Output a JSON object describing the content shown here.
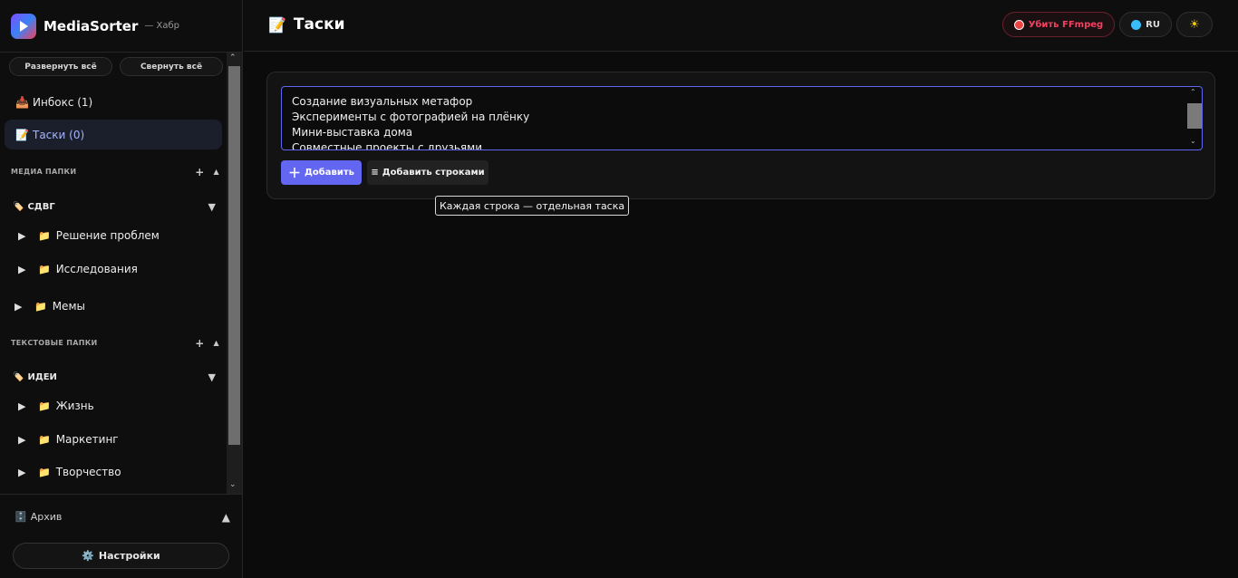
{
  "app": {
    "name": "MediaSorter",
    "subtitle": "— Хабр"
  },
  "sidebar": {
    "expand_all": "Развернуть всё",
    "collapse_all": "Свернуть всё",
    "nav": [
      {
        "icon": "📥",
        "label": "Инбокс (1)"
      },
      {
        "icon": "📝",
        "label": "Таски (0)"
      }
    ],
    "media_section": {
      "title": "медиа папки",
      "add": "+",
      "collapse": "▲"
    },
    "media_groups": [
      {
        "icon": "🏷️",
        "label": "СДВГ",
        "toggle": "▼",
        "folders": [
          "Решение проблем",
          "Исследования"
        ]
      }
    ],
    "media_root_folders": [
      "Мемы"
    ],
    "text_section": {
      "title": "текстовые папки",
      "add": "+",
      "collapse": "▲"
    },
    "text_groups": [
      {
        "icon": "🏷️",
        "label": "ИДЕИ",
        "toggle": "▼",
        "folders": [
          "Жизнь",
          "Маркетинг",
          "Творчество"
        ]
      }
    ],
    "archive": {
      "icon": "🗄️",
      "label": "Архив",
      "toggle": "▲"
    },
    "settings": {
      "icon": "⚙️",
      "label": "Настройки"
    }
  },
  "header": {
    "icon": "📝",
    "title": "Таски",
    "kill_ffmpeg": "Убить FFmpeg",
    "lang": "RU",
    "theme_icon": "☀"
  },
  "task_form": {
    "lines": [
      "Создание визуальных метафор",
      "Эксперименты с фотографией на плёнку",
      "Мини-выставка дома",
      "Совместные проекты с друзьями"
    ],
    "add_button": "Добавить",
    "add_lines_button": "Добавить строками",
    "tooltip": "Каждая строка — отдельная таска"
  },
  "colors": {
    "accent": "#6366f1",
    "danger": "#f43f5e",
    "lang_dot": "#38bdf8",
    "theme_dot": "#facc15"
  }
}
